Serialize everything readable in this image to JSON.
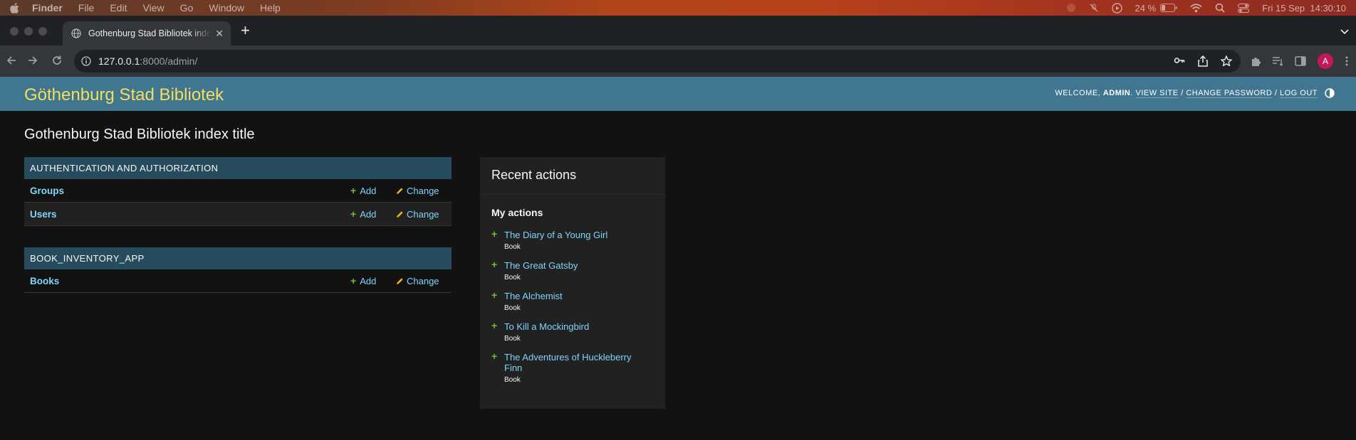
{
  "menubar": {
    "app": "Finder",
    "items": [
      "File",
      "Edit",
      "View",
      "Go",
      "Window",
      "Help"
    ],
    "battery": "24 %",
    "datetime": "Fri 15 Sep  14:30:10"
  },
  "browser": {
    "tab_title": "Gothenburg Stad Bibliotek index title",
    "url_host": "127.0.0.1",
    "url_rest": ":8000/admin/",
    "avatar_letter": "A"
  },
  "header": {
    "site_name": "Göthenburg Stad Bibliotek",
    "welcome": "Welcome,",
    "username": "admin",
    "view_site": "View site",
    "change_password": "Change password",
    "log_out": "Log out",
    "sep": "/"
  },
  "page": {
    "title": "Gothenburg Stad Bibliotek index title"
  },
  "modules": [
    {
      "caption": "Authentication and Authorization",
      "models": [
        {
          "name": "Groups",
          "add": "Add",
          "change": "Change"
        },
        {
          "name": "Users",
          "add": "Add",
          "change": "Change"
        }
      ]
    },
    {
      "caption": "BOOK_INVENTORY_APP",
      "models": [
        {
          "name": "Books",
          "add": "Add",
          "change": "Change"
        }
      ]
    }
  ],
  "recent": {
    "title": "Recent actions",
    "subtitle": "My actions",
    "actions": [
      {
        "title": "The Diary of a Young Girl",
        "type": "Book"
      },
      {
        "title": "The Great Gatsby",
        "type": "Book"
      },
      {
        "title": "The Alchemist",
        "type": "Book"
      },
      {
        "title": "To Kill a Mockingbird",
        "type": "Book"
      },
      {
        "title": "The Adventures of Huckleberry Finn",
        "type": "Book"
      }
    ]
  },
  "colors": {
    "header_bg": "#417690",
    "site_name": "#f5dd5d",
    "module_caption": "#264b5d",
    "link": "#81d4fa",
    "add_icon": "#70bf2b",
    "change_icon": "#efb80b"
  }
}
